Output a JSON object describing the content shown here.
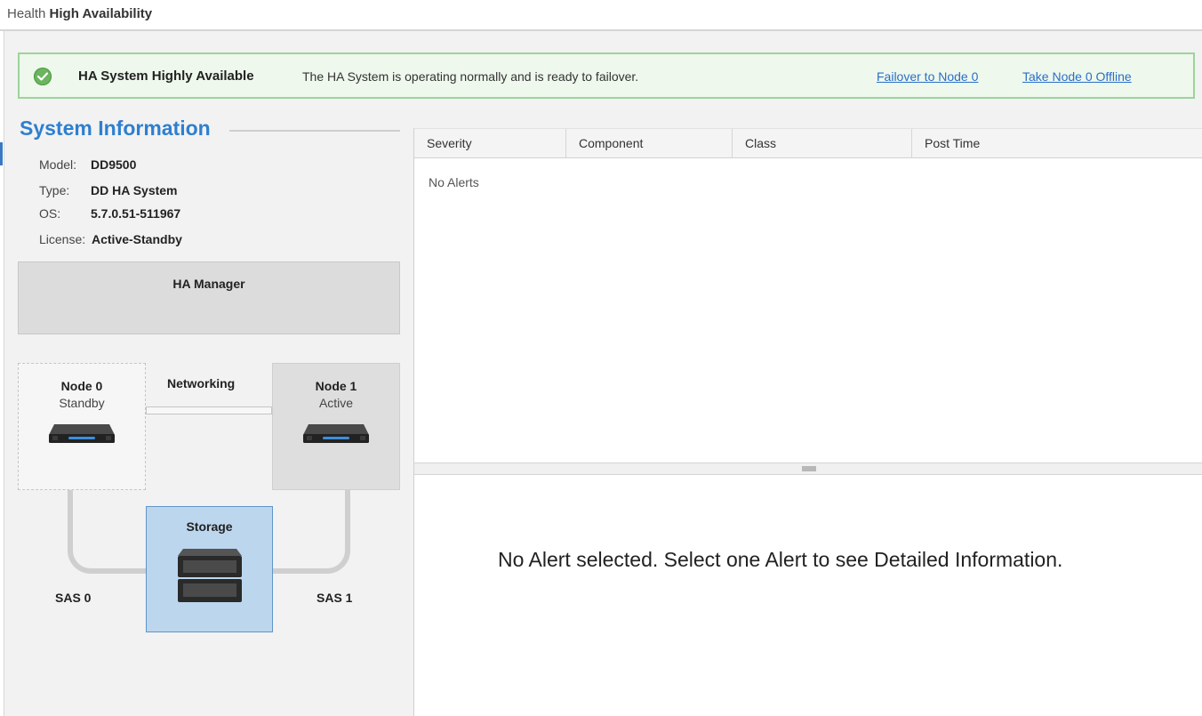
{
  "breadcrumb": {
    "section": "Health",
    "page": "High Availability"
  },
  "status": {
    "icon": "check-circle-icon",
    "title": "HA System Highly Available",
    "message": "The HA System is operating normally and is ready to failover.",
    "actions": [
      "Failover to Node 0",
      "Take Node 0 Offline"
    ],
    "color": "#6cb460"
  },
  "system_info": {
    "title": "System Information",
    "fields": [
      {
        "label": "Model:",
        "value": "DD9500"
      },
      {
        "label": "Type:",
        "value": "DD HA System"
      },
      {
        "label": "OS:",
        "value": "5.7.0.51-511967"
      },
      {
        "label": "License:",
        "value": "Active-Standby"
      }
    ]
  },
  "topology": {
    "ha_manager": "HA Manager",
    "networking": "Networking",
    "node0": {
      "name": "Node 0",
      "state": "Standby"
    },
    "node1": {
      "name": "Node 1",
      "state": "Active"
    },
    "storage": "Storage",
    "sas0": "SAS 0",
    "sas1": "SAS 1"
  },
  "alerts": {
    "columns": [
      "Severity",
      "Component",
      "Class",
      "Post Time"
    ],
    "empty_text": "No Alerts",
    "detail_empty": "No Alert selected. Select one Alert to see Detailed Information."
  },
  "colors": {
    "accent": "#2e7fd0",
    "storage_fill": "#bcd6ee",
    "banner_border": "#9cd49a"
  }
}
